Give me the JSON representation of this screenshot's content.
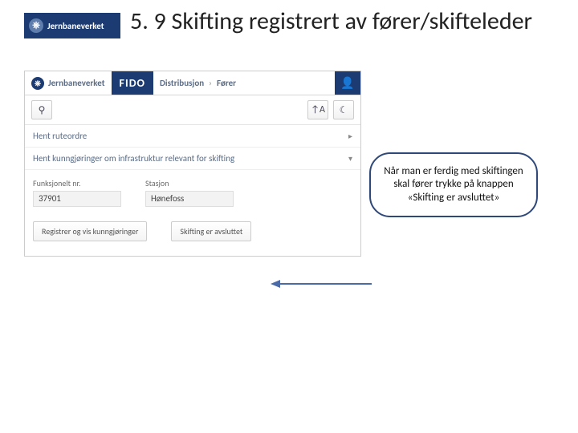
{
  "slide": {
    "title": "5. 9 Skifting registrert av fører/skifteleder",
    "logo_text": "Jernbaneverket"
  },
  "app": {
    "brand": "Jernbaneverket",
    "product": "FIDO",
    "breadcrumb_section": "Distribusjon",
    "breadcrumb_page": "Fører",
    "link_fetch_route": "Hent ruteordre",
    "link_fetch_announcements": "Hent kunngjøringer om infrastruktur relevant for skifting",
    "fields": {
      "funksjonelt_nr_label": "Funksjonelt nr.",
      "funksjonelt_nr_value": "37901",
      "stasjon_label": "Stasjon",
      "stasjon_value": "Hønefoss"
    },
    "buttons": {
      "register_view": "Registrer og vis kunngjøringer",
      "shifting_done": "Skifting er avsluttet"
    },
    "icons": {
      "search": "⚲",
      "sort": "↑A",
      "moon": "☾",
      "user": "👤",
      "chev_right": "▸",
      "chev_down": "▾"
    }
  },
  "callout": {
    "text": "Når man er ferdig med skiftingen skal fører trykke på knappen «Skifting er avsluttet»"
  }
}
